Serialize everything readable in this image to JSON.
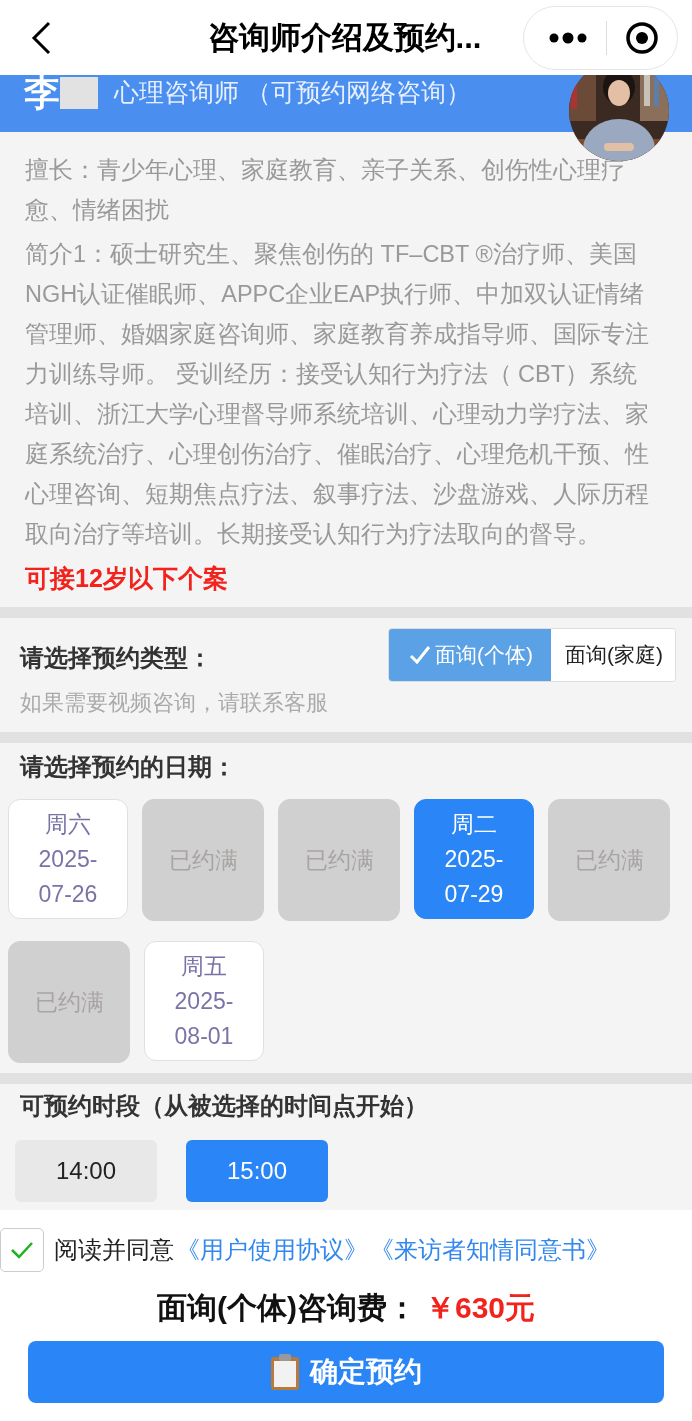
{
  "nav": {
    "title": "咨询师介绍及预约..."
  },
  "header": {
    "name": "李",
    "role": "心理咨询师  （可预约网络咨询）"
  },
  "profile": {
    "specialties": "擅长：青少年心理、家庭教育、亲子关系、创伤性心理疗愈、情绪困扰",
    "intro": "简介1：硕士研究生、聚焦创伤的 TF–CBT ®治疗师、美国NGH认证催眠师、APPC企业EAP执行师、中加双认证情绪管理师、婚姻家庭咨询师、家庭教育养成指导师、国际专注力训练导师。 受训经历：接受认知行为疗法（ CBT）系统培训、浙江大学心理督导师系统培训、心理动力学疗法、家庭系统治疗、心理创伤治疗、催眠治疗、心理危机干预、性心理咨询、短期焦点疗法、叙事疗法、沙盘游戏、人际历程取向治疗等培训。长期接受认知行为疗法取向的督导。",
    "note": "可接12岁以下个案"
  },
  "type_section": {
    "title": "请选择预约类型：",
    "hint": "如果需要视频咨询，请联系客服",
    "options": [
      {
        "label": "面询(个体)",
        "selected": true
      },
      {
        "label": "面询(家庭)",
        "selected": false
      }
    ]
  },
  "date_section": {
    "title": "请选择预约的日期：",
    "dates": [
      {
        "kind": "open",
        "weekday": "周六",
        "date": "2025-07-26",
        "selected": false
      },
      {
        "kind": "full",
        "label": "已约满"
      },
      {
        "kind": "full",
        "label": "已约满"
      },
      {
        "kind": "open",
        "weekday": "周二",
        "date": "2025-07-29",
        "selected": true
      },
      {
        "kind": "full",
        "label": "已约满"
      },
      {
        "kind": "full",
        "label": "已约满"
      },
      {
        "kind": "open",
        "weekday": "周五",
        "date": "2025-08-01",
        "selected": false
      }
    ]
  },
  "time_section": {
    "title": "可预约时段（从被选择的时间点开始）",
    "slots": [
      {
        "label": "14:00",
        "selected": false
      },
      {
        "label": "15:00",
        "selected": true
      }
    ]
  },
  "agreement": {
    "checked": true,
    "prefix": "阅读并同意",
    "links": [
      "《用户使用协议》",
      "《来访者知情同意书》"
    ]
  },
  "price": {
    "label": "面询(个体)咨询费：",
    "value": "￥630元"
  },
  "submit": {
    "label": "确定预约"
  }
}
